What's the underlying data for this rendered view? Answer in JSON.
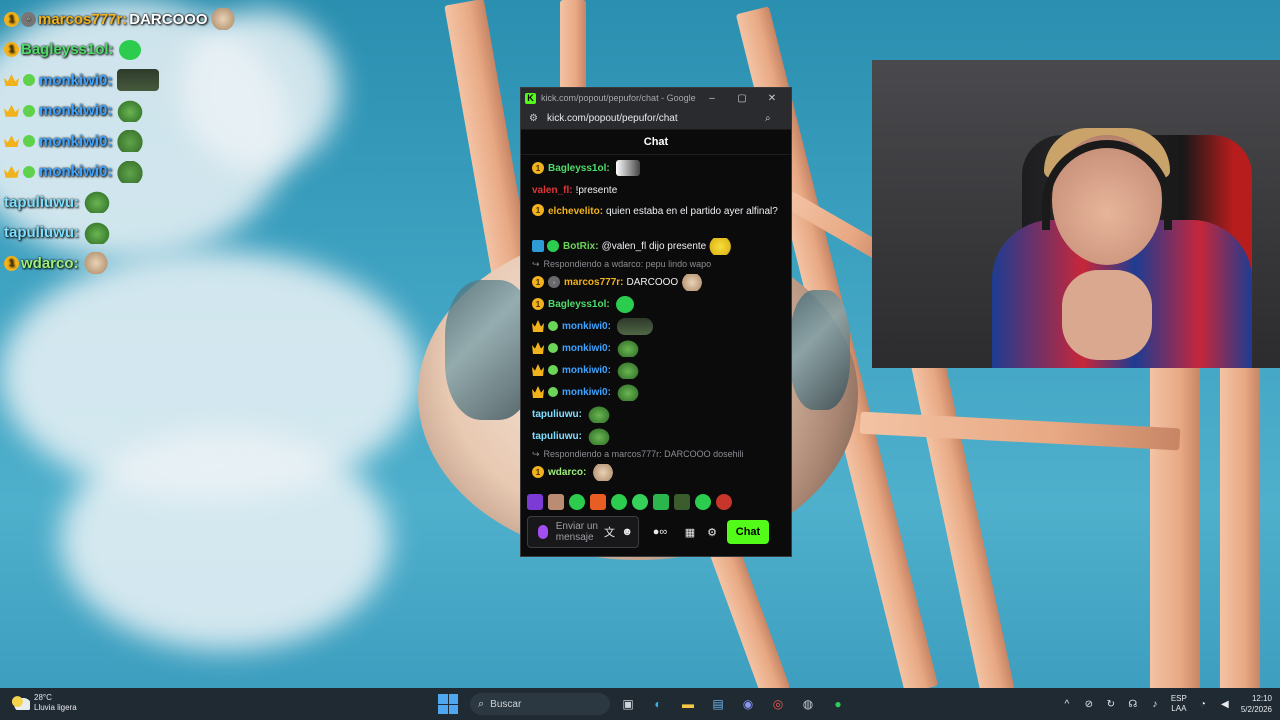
{
  "overlay_chat": [
    {
      "badges": [
        "sub-1",
        "gray"
      ],
      "user": "marcos777r:",
      "user_color": "#f2b21b",
      "text": "DARCOOO",
      "emotes": [
        "cat"
      ]
    },
    {
      "badges": [
        "sub-1"
      ],
      "user": "Bagleyss1ol:",
      "user_color": "#4fdc6a",
      "text": "",
      "emotes": [
        "green"
      ]
    },
    {
      "badges": [
        "crown",
        "sub"
      ],
      "user": "monkiwi0:",
      "user_color": "#3ea3ff",
      "text": "",
      "emotes": [
        "dark"
      ]
    },
    {
      "badges": [
        "crown",
        "sub"
      ],
      "user": "monkiwi0:",
      "user_color": "#3ea3ff",
      "text": "",
      "emotes": [
        "pepe"
      ]
    },
    {
      "badges": [
        "crown",
        "sub"
      ],
      "user": "monkiwi0:",
      "user_color": "#3ea3ff",
      "text": "",
      "emotes": [
        "frog"
      ]
    },
    {
      "badges": [
        "crown",
        "sub"
      ],
      "user": "monkiwi0:",
      "user_color": "#3ea3ff",
      "text": "",
      "emotes": [
        "frog"
      ]
    },
    {
      "badges": [],
      "user": "tapuliuwu:",
      "user_color": "#7ee0ff",
      "text": "",
      "emotes": [
        "pepe"
      ]
    },
    {
      "badges": [],
      "user": "tapuliuwu:",
      "user_color": "#7ee0ff",
      "text": "",
      "emotes": [
        "pepe"
      ]
    },
    {
      "badges": [
        "sub-1"
      ],
      "user": "wdarco:",
      "user_color": "#9ef07a",
      "text": "",
      "emotes": [
        "cat"
      ]
    }
  ],
  "window": {
    "title": "kick.com/popout/pepufor/chat - Google Chr...",
    "url": "kick.com/popout/pepufor/chat",
    "controls": {
      "minimize": "–",
      "maximize": "▢",
      "close": "✕"
    }
  },
  "chat": {
    "header": "Chat",
    "messages": [
      {
        "kind": "msg",
        "badges": [
          "sub-1"
        ],
        "user": "Bagleyss1ol:",
        "user_color": "#4fdc6a",
        "text": "",
        "emote": "img"
      },
      {
        "kind": "msg",
        "badges": [],
        "user": "valen_fl:",
        "user_color": "#e0363a",
        "text": "!presente",
        "emote": ""
      },
      {
        "kind": "tall",
        "badges": [
          "sub-1"
        ],
        "user": "elchevelito:",
        "user_color": "#f2b21b",
        "text": "quien estaba en el partido ayer alfinal?",
        "emote": ""
      },
      {
        "kind": "msg",
        "badges": [
          "bot"
        ],
        "user": "BotRix:",
        "user_color": "#6cd457",
        "text": "@valen_fl dijo presente",
        "emote": "yellow"
      },
      {
        "kind": "reply",
        "text": "Respondiendo a wdarco: pepu lindo wapo"
      },
      {
        "kind": "msg",
        "badges": [
          "sub-1",
          "gray"
        ],
        "user": "marcos777r:",
        "user_color": "#f2b21b",
        "text": "DARCOOO",
        "emote": "cat"
      },
      {
        "kind": "msg",
        "badges": [
          "sub-1"
        ],
        "user": "Bagleyss1ol:",
        "user_color": "#4fdc6a",
        "text": "",
        "emote": "green"
      },
      {
        "kind": "msg",
        "badges": [
          "crown",
          "sub"
        ],
        "user": "monkiwi0:",
        "user_color": "#3ea3ff",
        "text": "",
        "emote": "dark"
      },
      {
        "kind": "msg",
        "badges": [
          "crown",
          "sub"
        ],
        "user": "monkiwi0:",
        "user_color": "#3ea3ff",
        "text": "",
        "emote": "frog"
      },
      {
        "kind": "msg",
        "badges": [
          "crown",
          "sub"
        ],
        "user": "monkiwi0:",
        "user_color": "#3ea3ff",
        "text": "",
        "emote": "frog"
      },
      {
        "kind": "msg",
        "badges": [
          "crown",
          "sub"
        ],
        "user": "monkiwi0:",
        "user_color": "#3ea3ff",
        "text": "",
        "emote": "frog"
      },
      {
        "kind": "msg",
        "badges": [],
        "user": "tapuliuwu:",
        "user_color": "#7ee0ff",
        "text": "",
        "emote": "frog"
      },
      {
        "kind": "msg",
        "badges": [],
        "user": "tapuliuwu:",
        "user_color": "#7ee0ff",
        "text": "",
        "emote": "frog"
      },
      {
        "kind": "reply",
        "text": "Respondiendo a marcos777r: DARCOOO dosehili"
      },
      {
        "kind": "msg",
        "badges": [
          "sub-1"
        ],
        "user": "wdarco:",
        "user_color": "#9ef07a",
        "text": "",
        "emote": "cat"
      }
    ],
    "input_placeholder": "Enviar un mensaje",
    "send_label": "Chat",
    "accent": "#53fc18"
  },
  "taskbar": {
    "temperature": "28°C",
    "weather": "Lluvia ligera",
    "search_placeholder": "Buscar",
    "lang_top": "ESP",
    "lang_bottom": "LAA",
    "time": "12:10",
    "date": "5/2/2026"
  }
}
